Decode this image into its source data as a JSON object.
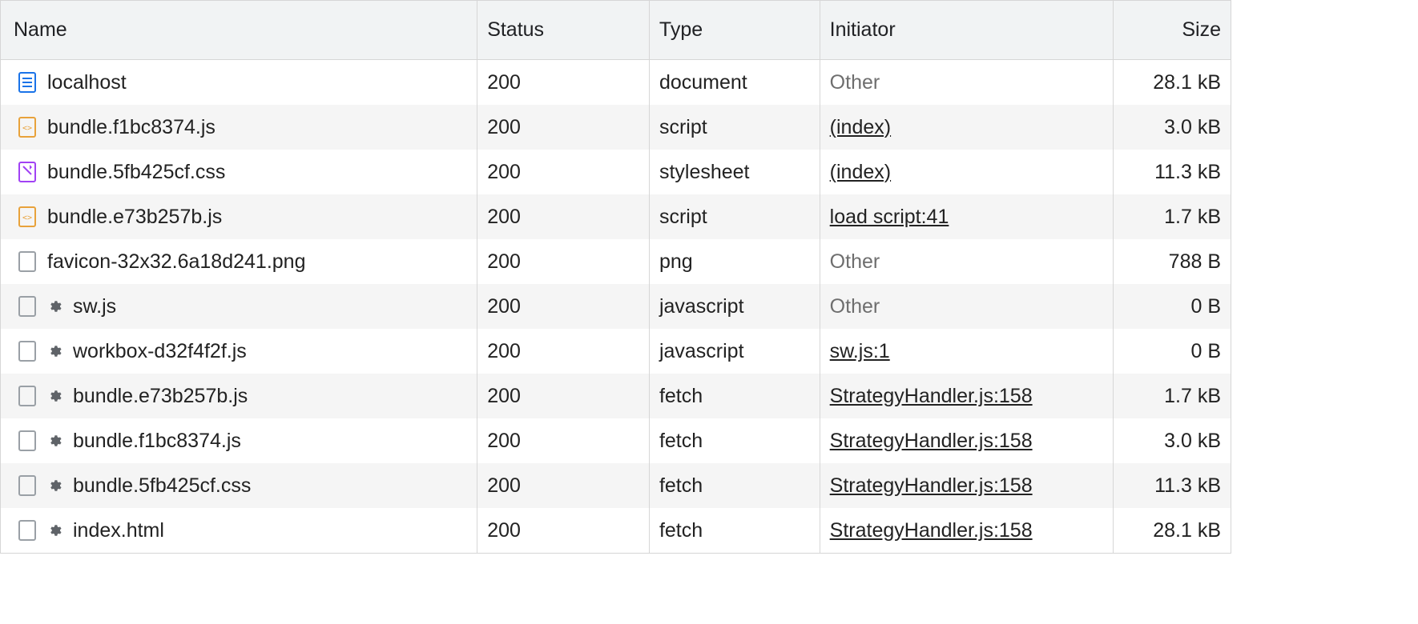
{
  "columns": {
    "name": "Name",
    "status": "Status",
    "type": "Type",
    "initiator": "Initiator",
    "size": "Size"
  },
  "rows": [
    {
      "icon": "document-icon",
      "gear": false,
      "name": "localhost",
      "status": "200",
      "type": "document",
      "initiator": "Other",
      "initiator_link": false,
      "size": "28.1 kB"
    },
    {
      "icon": "js-icon",
      "gear": false,
      "name": "bundle.f1bc8374.js",
      "status": "200",
      "type": "script",
      "initiator": "(index)",
      "initiator_link": true,
      "size": "3.0 kB"
    },
    {
      "icon": "css-icon",
      "gear": false,
      "name": "bundle.5fb425cf.css",
      "status": "200",
      "type": "stylesheet",
      "initiator": "(index)",
      "initiator_link": true,
      "size": "11.3 kB"
    },
    {
      "icon": "js-icon",
      "gear": false,
      "name": "bundle.e73b257b.js",
      "status": "200",
      "type": "script",
      "initiator": "load script:41",
      "initiator_link": true,
      "size": "1.7 kB"
    },
    {
      "icon": "file-icon",
      "gear": false,
      "name": "favicon-32x32.6a18d241.png",
      "status": "200",
      "type": "png",
      "initiator": "Other",
      "initiator_link": false,
      "size": "788 B"
    },
    {
      "icon": "file-icon",
      "gear": true,
      "name": "sw.js",
      "status": "200",
      "type": "javascript",
      "initiator": "Other",
      "initiator_link": false,
      "size": "0 B"
    },
    {
      "icon": "file-icon",
      "gear": true,
      "name": "workbox-d32f4f2f.js",
      "status": "200",
      "type": "javascript",
      "initiator": "sw.js:1",
      "initiator_link": true,
      "size": "0 B"
    },
    {
      "icon": "file-icon",
      "gear": true,
      "name": "bundle.e73b257b.js",
      "status": "200",
      "type": "fetch",
      "initiator": "StrategyHandler.js:158",
      "initiator_link": true,
      "size": "1.7 kB"
    },
    {
      "icon": "file-icon",
      "gear": true,
      "name": "bundle.f1bc8374.js",
      "status": "200",
      "type": "fetch",
      "initiator": "StrategyHandler.js:158",
      "initiator_link": true,
      "size": "3.0 kB"
    },
    {
      "icon": "file-icon",
      "gear": true,
      "name": "bundle.5fb425cf.css",
      "status": "200",
      "type": "fetch",
      "initiator": "StrategyHandler.js:158",
      "initiator_link": true,
      "size": "11.3 kB"
    },
    {
      "icon": "file-icon",
      "gear": true,
      "name": "index.html",
      "status": "200",
      "type": "fetch",
      "initiator": "StrategyHandler.js:158",
      "initiator_link": true,
      "size": "28.1 kB"
    }
  ]
}
